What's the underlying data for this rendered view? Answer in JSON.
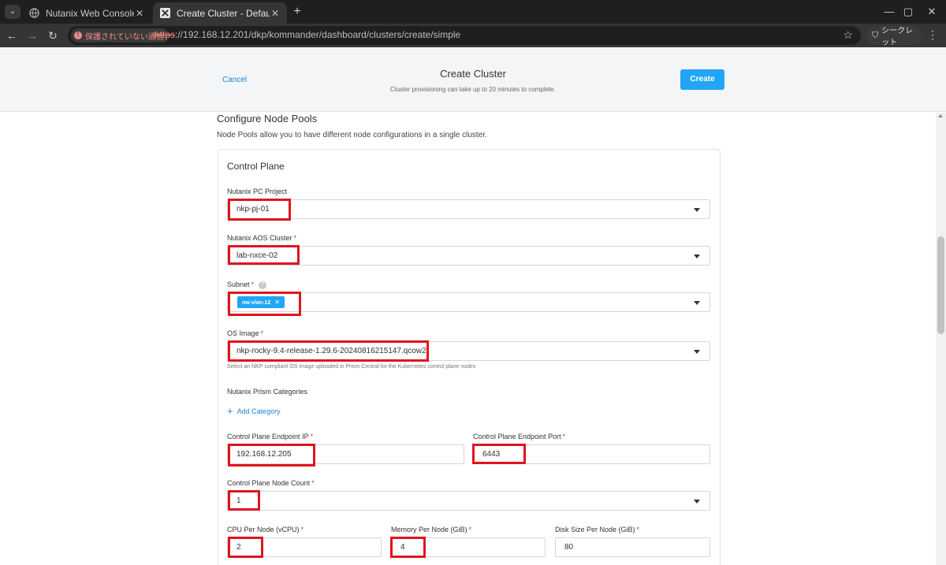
{
  "browser": {
    "tabs": [
      {
        "title": "Nutanix Web Console",
        "active": false
      },
      {
        "title": "Create Cluster - Default Workspa",
        "active": true
      }
    ],
    "security_label": "保護されていない通信",
    "url_proto": "https",
    "url_rest": "://192.168.12.201/dkp/kommander/dashboard/clusters/create/simple",
    "incognito_label": "シークレット"
  },
  "header": {
    "cancel_label": "Cancel",
    "title": "Create Cluster",
    "subtitle": "Cluster provisioning can take up to 20 minutes to complete.",
    "create_label": "Create"
  },
  "section": {
    "title": "Configure Node Pools",
    "description": "Node Pools allow you to have different node configurations in a single cluster."
  },
  "control_plane": {
    "title": "Control Plane",
    "pc_project": {
      "label": "Nutanix PC Project",
      "value": "nkp-pj-01"
    },
    "aos_cluster": {
      "label": "Nutanix AOS Cluster",
      "value": "lab-nxce-02"
    },
    "subnet": {
      "label": "Subnet",
      "tag": "nw-vlan-12"
    },
    "os_image": {
      "label": "OS Image",
      "value": "nkp-rocky-9.4-release-1.29.6-20240816215147.qcow2",
      "hint": "Select an NKP compliant OS image uploaded in Prism Central for the Kubernetes control plane nodes"
    },
    "categories": {
      "label": "Nutanix Prism Categories",
      "add_label": "Add Category"
    },
    "endpoint_ip": {
      "label": "Control Plane Endpoint IP",
      "value": "192.168.12.205"
    },
    "endpoint_port": {
      "label": "Control Plane Endpoint Port",
      "value": "6443"
    },
    "node_count": {
      "label": "Control Plane Node Count",
      "value": "1"
    },
    "cpu": {
      "label": "CPU Per Node (vCPU)",
      "value": "2"
    },
    "memory": {
      "label": "Memory Per Node (GiB)",
      "value": "4"
    },
    "disk": {
      "label": "Disk Size Per Node (GiB)",
      "value": "80"
    },
    "required_marker": "*"
  },
  "colors": {
    "accent": "#22a5f7",
    "link": "#1c86d8",
    "highlight": "#e0141f",
    "required": "#e0313b"
  }
}
